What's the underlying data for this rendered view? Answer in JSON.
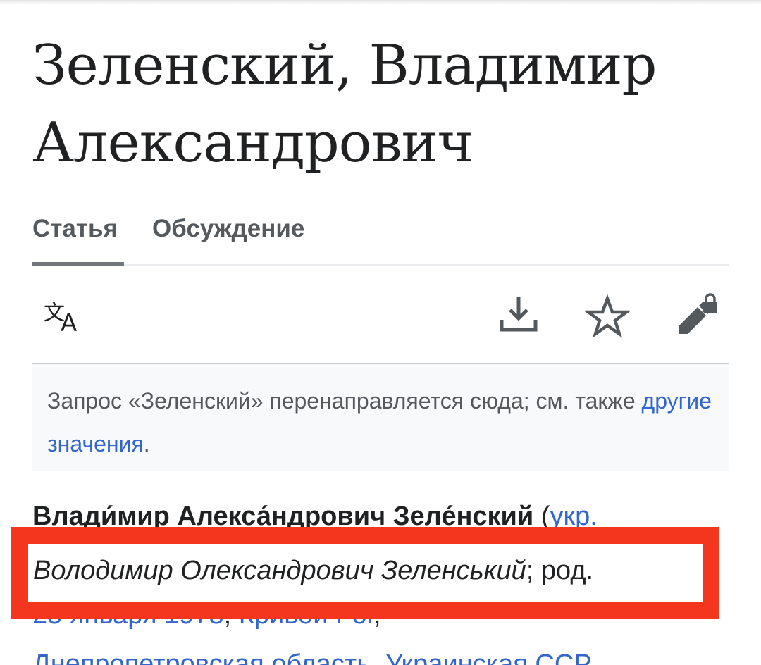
{
  "article": {
    "title": "Зеленский, Владимир Александрович"
  },
  "tabs": [
    {
      "label": "Статья",
      "active": true
    },
    {
      "label": "Обсуждение",
      "active": false
    }
  ],
  "toolbar": {
    "icons": [
      "translate-icon",
      "download-icon",
      "star-icon",
      "edit-locked-icon"
    ]
  },
  "hatnote": {
    "text_before": "Запрос «Зеленский» перенаправляется сюда; см. также ",
    "link": "другие значения",
    "text_after": "."
  },
  "lead": {
    "name_bold": "Влади́мир Алекса́ндрович Зеле́нский",
    "paren_open": " (",
    "lang_link": "укр.",
    "ukr_name": "Володимир Олександрович Зеленський",
    "after_ukr": "; род.",
    "birth_date_link": "25 января 1978",
    "comma1": ", ",
    "birthplace_link": "Кривой Рог",
    "comma2": ",",
    "line4_link": "Днепропетровская область, Украинская ССР"
  },
  "colors": {
    "link": "#3366cc",
    "highlight_frame": "#f3361d",
    "hatnote_bg": "#f8f9fa"
  }
}
